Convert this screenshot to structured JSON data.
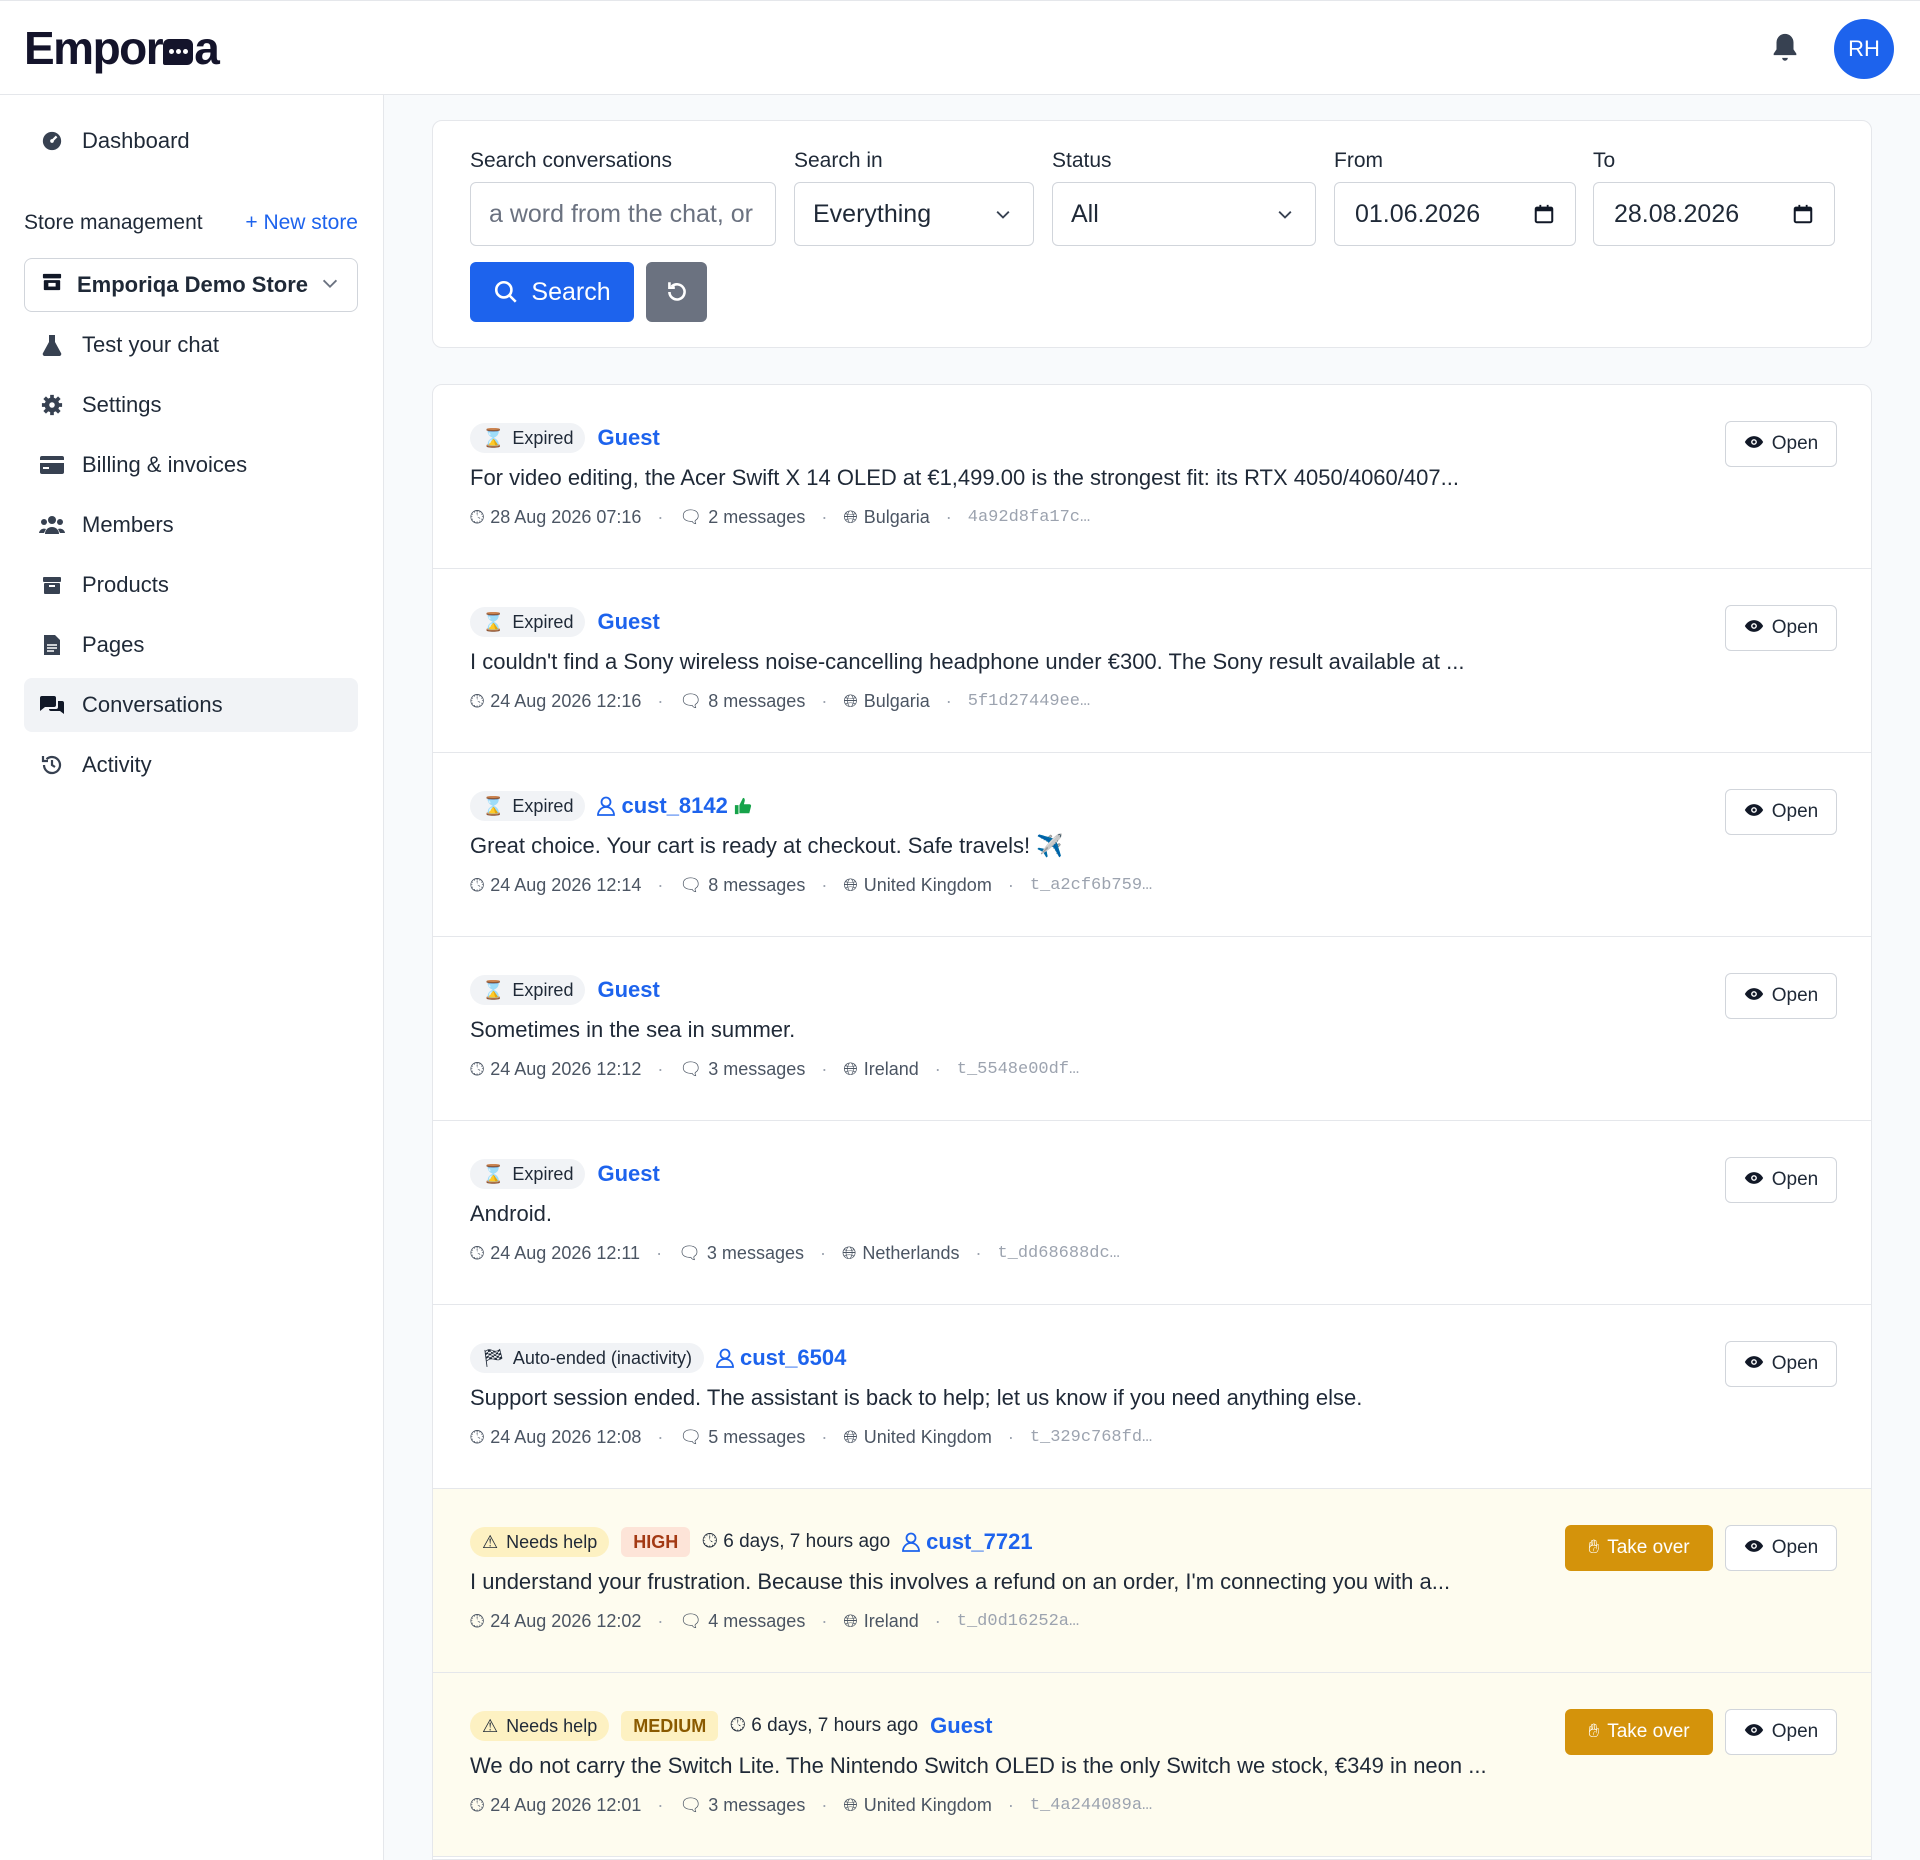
{
  "app": {
    "logo": "Emporiqa",
    "user_initials": "RH",
    "colors": {
      "primary": "#1d63ed",
      "alert_bg": "#fefcef",
      "take_over": "#d4930b"
    }
  },
  "sidebar": {
    "dashboard": "Dashboard",
    "store_management": "Store management",
    "new_store": "+ New store",
    "store_name": "Emporiqa Demo Store",
    "items": [
      {
        "label": "Test your chat",
        "icon": "flask-icon"
      },
      {
        "label": "Settings",
        "icon": "gear-icon"
      },
      {
        "label": "Billing & invoices",
        "icon": "credit-card-icon"
      },
      {
        "label": "Members",
        "icon": "users-icon"
      },
      {
        "label": "Products",
        "icon": "box-icon"
      },
      {
        "label": "Pages",
        "icon": "document-icon"
      },
      {
        "label": "Conversations",
        "icon": "chat-bubbles-icon",
        "active": true
      },
      {
        "label": "Activity",
        "icon": "history-icon"
      }
    ]
  },
  "filters": {
    "search_label": "Search conversations",
    "search_placeholder": "a word from the chat, or",
    "search_in_label": "Search in",
    "search_in_value": "Everything",
    "status_label": "Status",
    "status_value": "All",
    "from_label": "From",
    "from_value": "01.06.2026",
    "to_label": "To",
    "to_value": "28.08.2026",
    "search_button": "Search"
  },
  "conversations": [
    {
      "status": "Expired",
      "user": "Guest",
      "message": "For video editing, the Acer Swift X 14 OLED at €1,499.00 is the strongest fit: its RTX 4050/4060/407...",
      "date": "28 Aug 2026 07:16",
      "messages": "2 messages",
      "country": "Bulgaria",
      "id": "4a92d8fa17c…",
      "open": "Open"
    },
    {
      "status": "Expired",
      "user": "Guest",
      "message": "I couldn't find a Sony wireless noise-cancelling headphone under €300. The Sony result available at ...",
      "date": "24 Aug 2026 12:16",
      "messages": "8 messages",
      "country": "Bulgaria",
      "id": "5f1d27449ee…",
      "open": "Open"
    },
    {
      "status": "Expired",
      "user": "cust_8142",
      "message": "Great choice. Your cart is ready at checkout. Safe travels! ✈️",
      "date": "24 Aug 2026 12:14",
      "messages": "8 messages",
      "country": "United Kingdom",
      "id": "t_a2cf6b759…",
      "open": "Open"
    },
    {
      "status": "Expired",
      "user": "Guest",
      "message": "Sometimes in the sea in summer.",
      "date": "24 Aug 2026 12:12",
      "messages": "3 messages",
      "country": "Ireland",
      "id": "t_5548e00df…",
      "open": "Open"
    },
    {
      "status": "Expired",
      "user": "Guest",
      "message": "Android.",
      "date": "24 Aug 2026 12:11",
      "messages": "3 messages",
      "country": "Netherlands",
      "id": "t_dd68688dc…",
      "open": "Open"
    },
    {
      "status": "Auto-ended (inactivity)",
      "user": "cust_6504",
      "message": "Support session ended. The assistant is back to help; let us know if you need anything else.",
      "date": "24 Aug 2026 12:08",
      "messages": "5 messages",
      "country": "United Kingdom",
      "id": "t_329c768fd…",
      "open": "Open"
    },
    {
      "status": "Needs help",
      "priority": "HIGH",
      "since": "6 days, 7 hours ago",
      "user": "cust_7721",
      "message": "I understand your frustration. Because this involves a refund on an order, I'm connecting you with a...",
      "date": "24 Aug 2026 12:02",
      "messages": "4 messages",
      "country": "Ireland",
      "id": "t_d0d16252a…",
      "take_over": "Take over",
      "open": "Open"
    },
    {
      "status": "Needs help",
      "priority": "MEDIUM",
      "since": "6 days, 7 hours ago",
      "user": "Guest",
      "message": "We do not carry the Switch Lite. The Nintendo Switch OLED is the only Switch we stock, €349 in neon ...",
      "date": "24 Aug 2026 12:01",
      "messages": "3 messages",
      "country": "United Kingdom",
      "id": "t_4a244089a…",
      "take_over": "Take over",
      "open": "Open"
    }
  ]
}
